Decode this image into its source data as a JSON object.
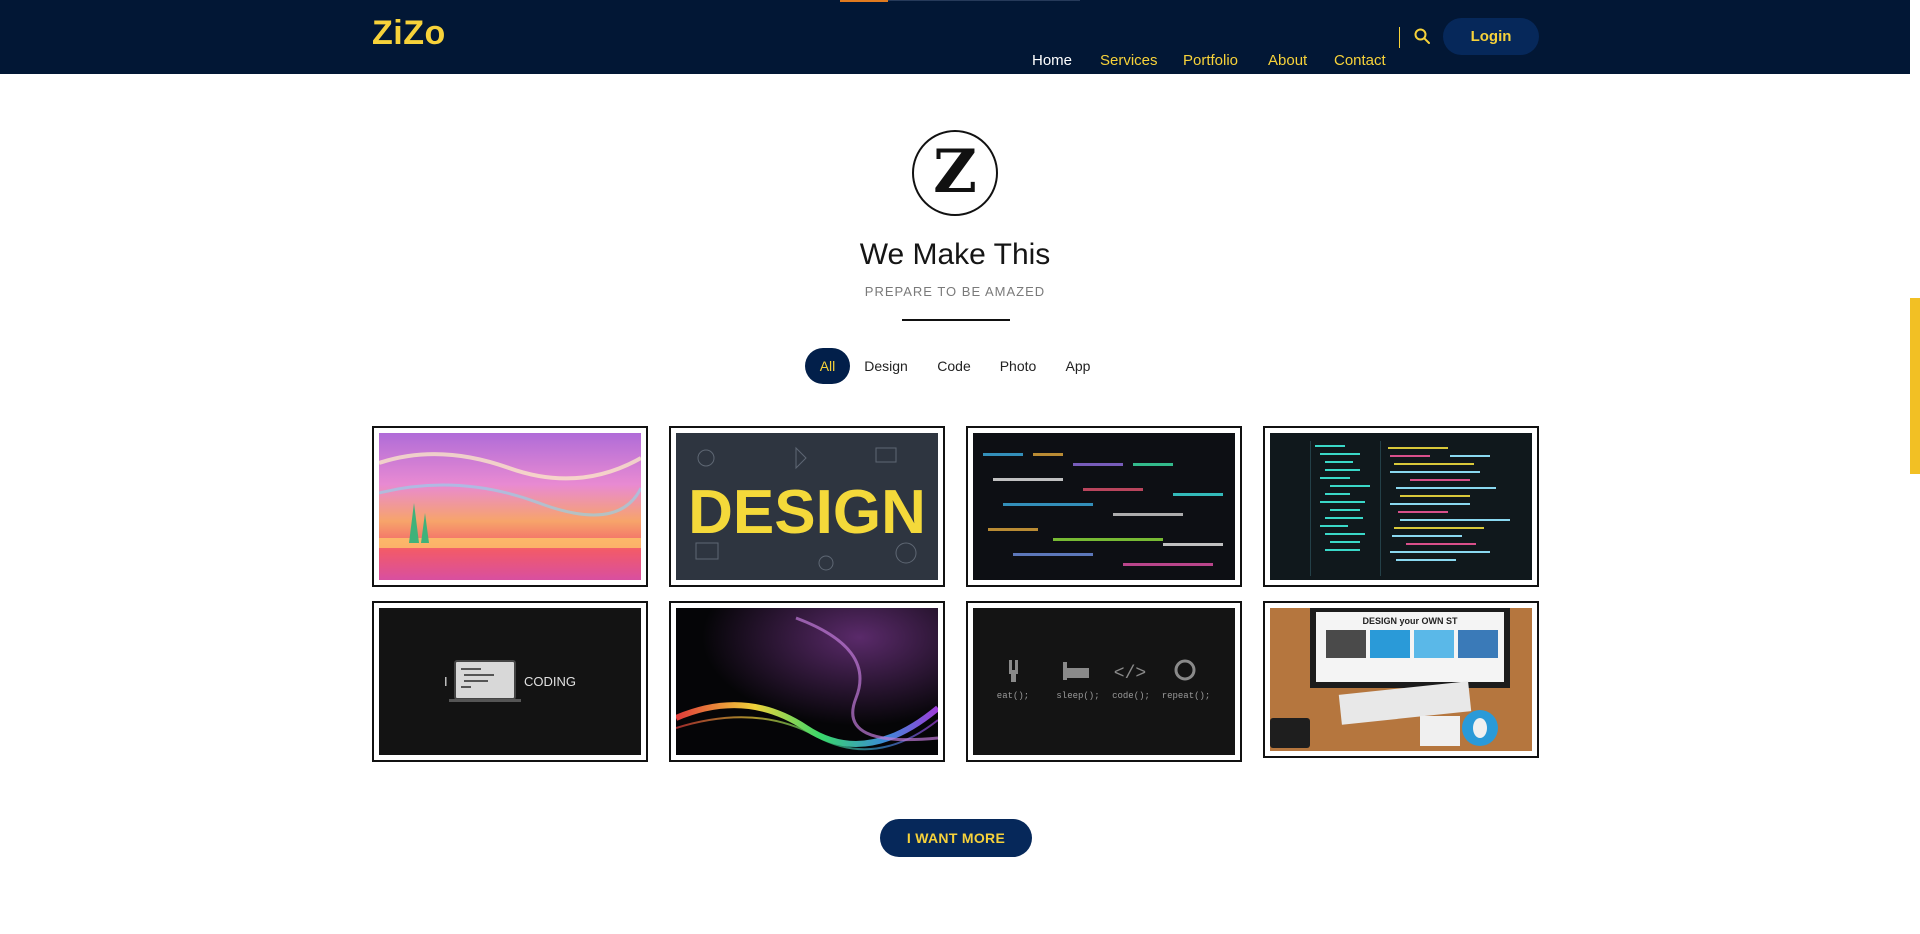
{
  "brand": {
    "logo_text": "ZiZo",
    "accent": "#f7d23a",
    "nav_bg": "#021735"
  },
  "nav": {
    "items": [
      "Home",
      "Services",
      "Portfolio",
      "About",
      "Contact"
    ],
    "active": "Home",
    "login_label": "Login",
    "search_icon": "search-icon"
  },
  "hero": {
    "emblem_letter": "Z",
    "title": "We Make This",
    "subtitle": "PREPARE TO BE AMAZED"
  },
  "filters": {
    "items": [
      "All",
      "Design",
      "Code",
      "Photo",
      "App"
    ],
    "active": "All"
  },
  "gallery": {
    "tiles": [
      {
        "name": "painting-landscape"
      },
      {
        "name": "design-word-art",
        "text": "DESIGN"
      },
      {
        "name": "code-screen-blur"
      },
      {
        "name": "code-editor-screen"
      },
      {
        "name": "i-love-coding",
        "text_left": "I",
        "text_right": "CODING"
      },
      {
        "name": "abstract-light-wave"
      },
      {
        "name": "eat-sleep-code-repeat",
        "labels": [
          "eat();",
          "sleep();",
          "code();",
          "repeat();"
        ]
      },
      {
        "name": "design-your-own-style",
        "text": "DESIGN your OWN ST"
      }
    ]
  },
  "cta": {
    "more_label": "I WANT MORE"
  }
}
